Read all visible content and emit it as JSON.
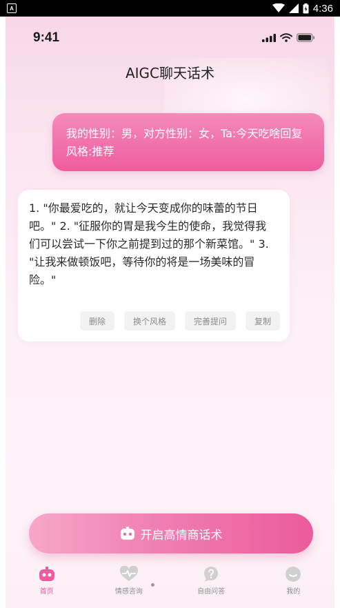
{
  "android_status": {
    "time": "4:36"
  },
  "ios_status": {
    "time": "9:41"
  },
  "header": {
    "title": "AIGC聊天话术"
  },
  "user_message": {
    "text": "我的性别：男，对方性别：女，Ta:今天吃啥回复风格:推荐"
  },
  "bot_message": {
    "text": "1. \"你最爱吃的，就让今天变成你的味蕾的节日吧。\" 2. \"征服你的胃是我今生的使命，我觉得我们可以尝试一下你之前提到过的那个新菜馆。\" 3. \"让我来做顿饭吧，等待你的将是一场美味的冒险。\"",
    "actions": {
      "delete": "删除",
      "change_style": "换个风格",
      "improve": "完善提问",
      "copy": "复制"
    }
  },
  "cta": {
    "label": "开启高情商话术"
  },
  "nav": {
    "home": "首页",
    "consult": "情感咨询",
    "qa": "自由问答",
    "mine": "我的"
  },
  "colors": {
    "accent": "#ef5c9f",
    "accent_light": "#f6a7c9"
  },
  "icons": [
    "robot-icon",
    "heart-pulse-icon",
    "question-bubble-icon",
    "profile-icon",
    "wifi-icon",
    "signal-icon",
    "battery-icon"
  ]
}
